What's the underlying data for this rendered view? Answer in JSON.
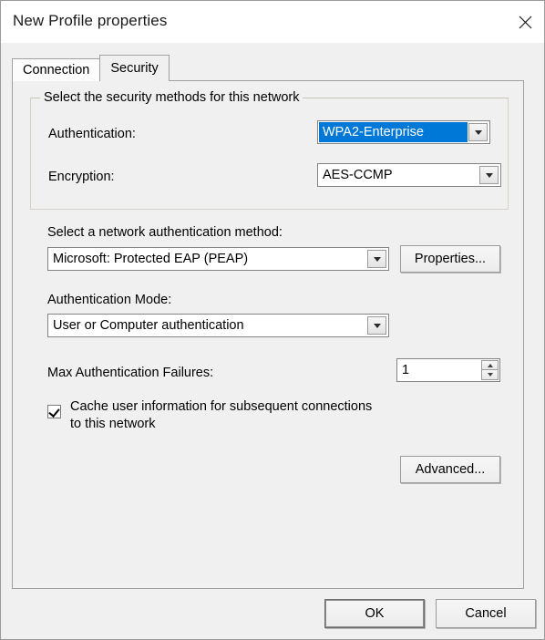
{
  "window": {
    "title": "New Profile properties",
    "close_icon": "close-icon"
  },
  "tabs": [
    {
      "label": "Connection",
      "active": false
    },
    {
      "label": "Security",
      "active": true
    }
  ],
  "security_tab": {
    "group": {
      "title": "Select the security methods for this network",
      "fields": [
        {
          "label": "Authentication:",
          "value": "WPA2-Enterprise",
          "highlighted": true
        },
        {
          "label": "Encryption:",
          "value": "AES-CCMP",
          "highlighted": false
        }
      ]
    },
    "auth_method": {
      "label": "Select a network authentication method:",
      "value": "Microsoft: Protected EAP (PEAP)",
      "properties_button": "Properties..."
    },
    "auth_mode": {
      "label": "Authentication Mode:",
      "value": "User or Computer authentication"
    },
    "max_failures": {
      "label": "Max Authentication Failures:",
      "value": "1"
    },
    "cache_checkbox": {
      "checked": true,
      "line1": "Cache user information for subsequent connections",
      "line2": "to this network"
    },
    "advanced_button": "Advanced..."
  },
  "footer": {
    "ok_label": "OK",
    "cancel_label": "Cancel"
  },
  "colors": {
    "accent_selection": "#0078d7",
    "dialog_background": "#f0f0f0",
    "titlebar_background": "#ffffff",
    "control_border": "#848484"
  }
}
